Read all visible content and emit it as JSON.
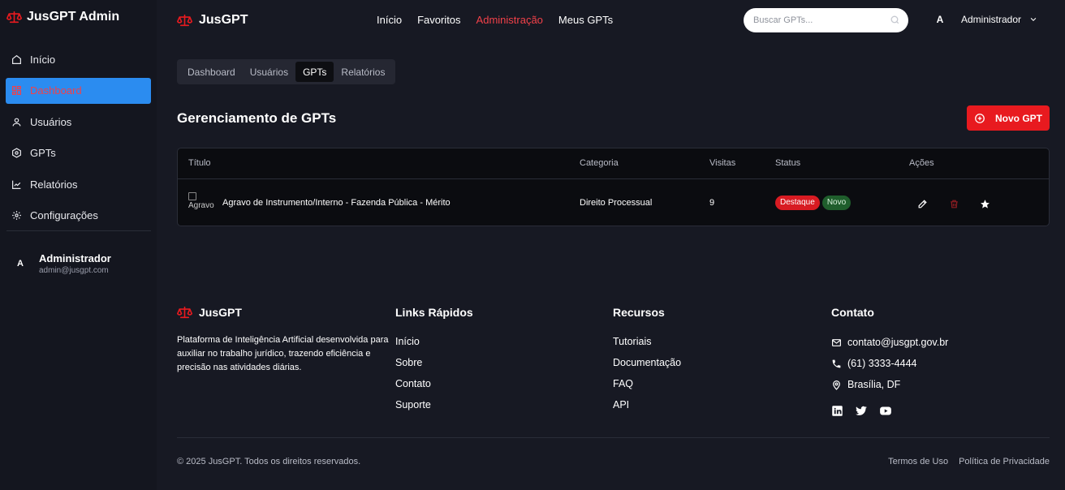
{
  "sidebar": {
    "brand": "JusGPT Admin",
    "items": [
      {
        "label": "Início",
        "icon": "home-icon"
      },
      {
        "label": "Dashboard",
        "icon": "grid-icon"
      },
      {
        "label": "Usuários",
        "icon": "user-icon"
      },
      {
        "label": "GPTs",
        "icon": "bot-icon"
      },
      {
        "label": "Relatórios",
        "icon": "chart-line-icon"
      },
      {
        "label": "Configurações",
        "icon": "gear-icon"
      }
    ],
    "active_item": "Dashboard",
    "user": {
      "initial": "A",
      "name": "Administrador",
      "email": "admin@jusgpt.com"
    }
  },
  "header": {
    "brand": "JusGPT",
    "nav": [
      "Início",
      "Favoritos",
      "Administração",
      "Meus GPTs"
    ],
    "active_nav": "Administração",
    "search_placeholder": "Buscar GPTs...",
    "user_initial": "A",
    "user_name": "Administrador"
  },
  "tabs": {
    "items": [
      "Dashboard",
      "Usuários",
      "GPTs",
      "Relatórios"
    ],
    "active": "GPTs"
  },
  "main": {
    "title": "Gerenciamento de GPTs",
    "new_button": "Novo GPT"
  },
  "table": {
    "columns": [
      "Título",
      "Categoria",
      "Visitas",
      "Status",
      "Ações"
    ],
    "rows": [
      {
        "image_alt": "Agravo",
        "title": "Agravo de Instrumento/Interno - Fazenda Pública - Mérito",
        "category": "Direito Processual",
        "visits": "9",
        "badges": [
          "Destaque",
          "Novo"
        ]
      }
    ]
  },
  "footer": {
    "brand": "JusGPT",
    "description": "Plataforma de Inteligência Artificial desenvolvida para auxiliar no trabalho jurídico, trazendo eficiência e precisão nas atividades diárias.",
    "quick_links_title": "Links Rápidos",
    "quick_links": [
      "Início",
      "Sobre",
      "Contato",
      "Suporte"
    ],
    "resources_title": "Recursos",
    "resources": [
      "Tutoriais",
      "Documentação",
      "FAQ",
      "API"
    ],
    "contact_title": "Contato",
    "contact": {
      "email": "contato@jusgpt.gov.br",
      "phone": "(61) 3333-4444",
      "location": "Brasília, DF"
    },
    "copyright": "© 2025 JusGPT. Todos os direitos reservados.",
    "legal": [
      "Termos de Uso",
      "Política de Privacidade"
    ]
  },
  "colors": {
    "accent_red": "#e81a1f",
    "active_blue": "#2b8cf0",
    "background": "#171923"
  }
}
